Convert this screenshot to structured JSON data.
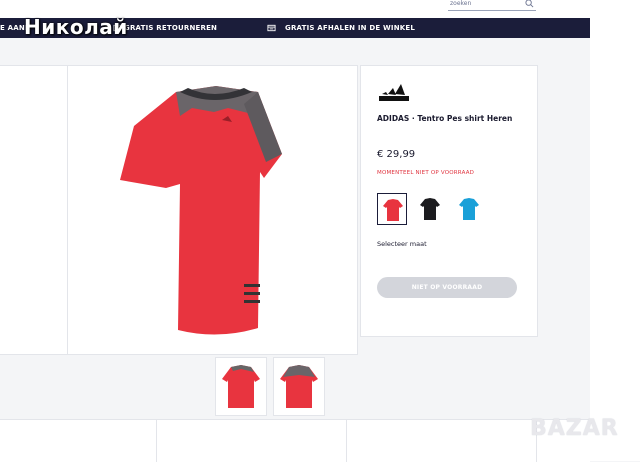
{
  "overlay": {
    "username": "Николай"
  },
  "header": {
    "search_placeholder": "zoeken"
  },
  "nav": {
    "items": [
      {
        "label": "E AANK"
      },
      {
        "label": "GRATIS RETOURNEREN"
      },
      {
        "label": "GRATIS AFHALEN IN DE WINKEL"
      }
    ]
  },
  "product": {
    "title": "ADIDAS · Tentro Pes shirt Heren",
    "price": "€ 29,99",
    "stock_status": "MOMENTEEL NIET OP VOORRAAD",
    "size_label": "Selecteer maat",
    "action_button": "NIET OP VOORRAAD",
    "colors": [
      {
        "name": "red",
        "hex": "#e8343f",
        "selected": true
      },
      {
        "name": "black",
        "hex": "#1c1c1f",
        "selected": false
      },
      {
        "name": "blue",
        "hex": "#1aa0d8",
        "selected": false
      }
    ]
  },
  "brand": {
    "logo_icon": "adidas-logo",
    "accent": "#1b1d3a"
  },
  "watermark": {
    "text": "BAZAR"
  }
}
